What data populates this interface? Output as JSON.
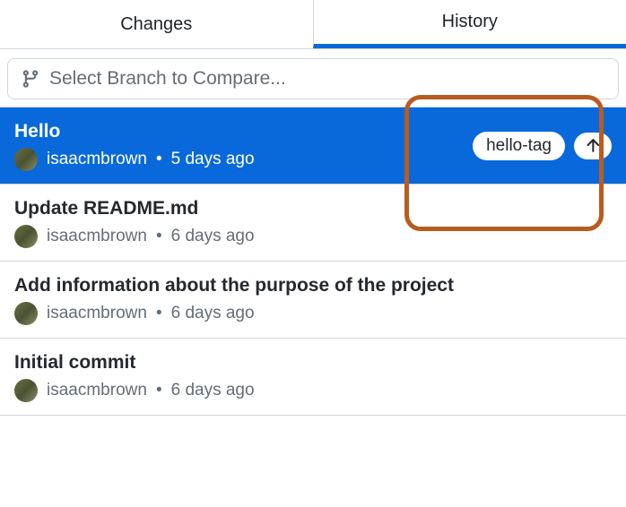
{
  "tabs": {
    "changes": "Changes",
    "history": "History"
  },
  "branchSelector": {
    "placeholder": "Select Branch to Compare..."
  },
  "commits": [
    {
      "title": "Hello",
      "author": "isaacmbrown",
      "time": "5 days ago",
      "tag": "hello-tag",
      "selected": true,
      "hasPush": true
    },
    {
      "title": "Update README.md",
      "author": "isaacmbrown",
      "time": "6 days ago"
    },
    {
      "title": "Add information about the purpose of the project",
      "author": "isaacmbrown",
      "time": "6 days ago"
    },
    {
      "title": "Initial commit",
      "author": "isaacmbrown",
      "time": "6 days ago"
    }
  ],
  "separator": "•"
}
